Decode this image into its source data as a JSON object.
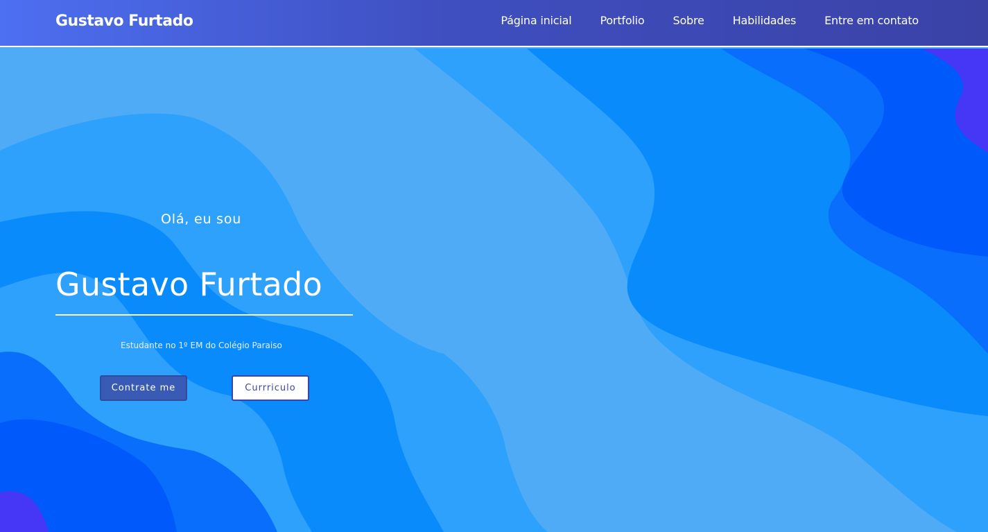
{
  "navbar": {
    "brand": "Gustavo Furtado",
    "links": [
      "Página inicial",
      "Portfolio",
      "Sobre",
      "Habilidades",
      "Entre em contato"
    ]
  },
  "hero": {
    "greeting": "Olá, eu sou",
    "name": "Gustavo Furtado",
    "subtitle": "Estudante no 1º EM do Colégio Paraiso",
    "hire_button": "Contrate me",
    "cv_button": "Currriculo"
  },
  "colors": {
    "nav_gradient_start": "#4d6ff1",
    "nav_gradient_end": "#3a42a6",
    "wave_lightest": "#4fabf6",
    "wave_light": "#2da1fc",
    "wave_mid": "#0a8bfb",
    "wave_deep": "#0a6efc",
    "wave_deeper": "#0059fb",
    "wave_violet": "#4636f5",
    "hire_button_bg": "#3a5bb5",
    "cv_button_border": "#3a44a8"
  }
}
